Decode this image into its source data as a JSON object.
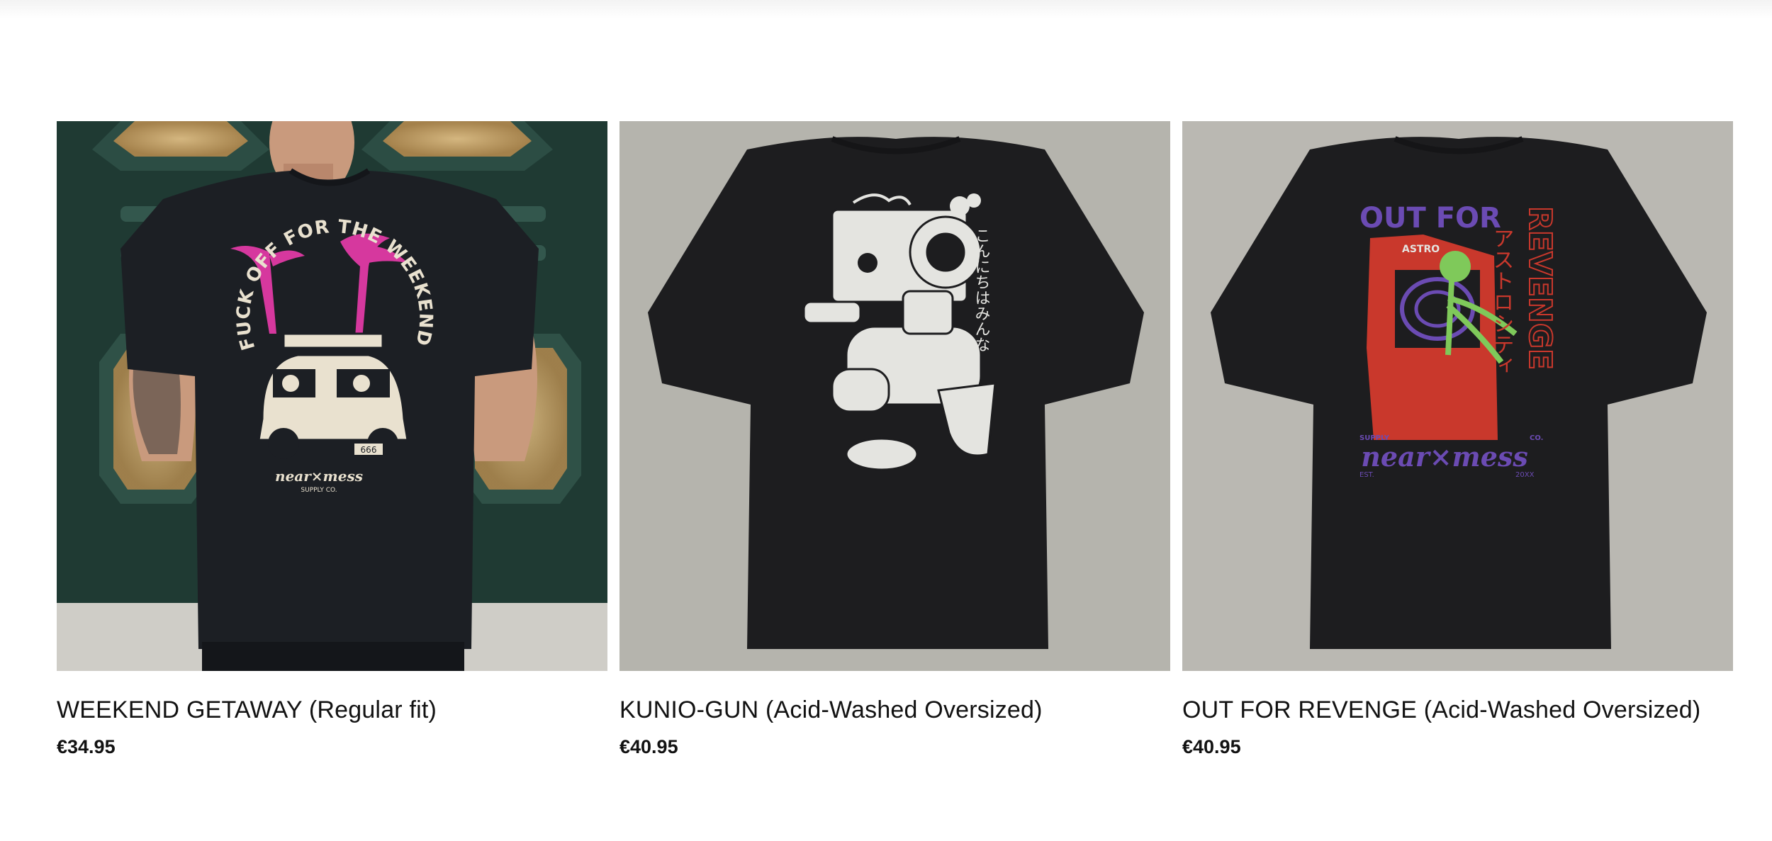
{
  "products": [
    {
      "title": "WEEKEND GETAWAY (Regular fit)",
      "price": "€34.95",
      "print": {
        "arc_text": "FUCK OFF FOR THE WEEKEND",
        "brand": "near×mess",
        "brand_sub": "SUPPLY CO.",
        "plate": "666"
      }
    },
    {
      "title": "KUNIO-GUN (Acid-Washed Oversized)",
      "price": "€40.95",
      "print": {
        "vertical_text": "こんにちはみんな"
      }
    },
    {
      "title": "OUT FOR REVENGE (Acid-Washed Oversized)",
      "price": "€40.95",
      "print": {
        "headline": "OUT FOR",
        "vertical_headline": "REVENGE",
        "katakana": "アストロシティ",
        "cabinet_label": "ASTRO",
        "supply": "SUPPLY",
        "co": "CO.",
        "brand": "near×mess",
        "est": "EST.",
        "year": "20XX"
      }
    }
  ],
  "colors": {
    "door_green": "#1f3a33",
    "shirt_black": "#1c1f24",
    "print_pink": "#d6389e",
    "print_cream": "#e9e1cf",
    "revenge_purple": "#6b4bb3",
    "revenge_red": "#c9382c",
    "skeleton_green": "#7fc95a",
    "backdrop_grey": "#b9b7b1"
  }
}
